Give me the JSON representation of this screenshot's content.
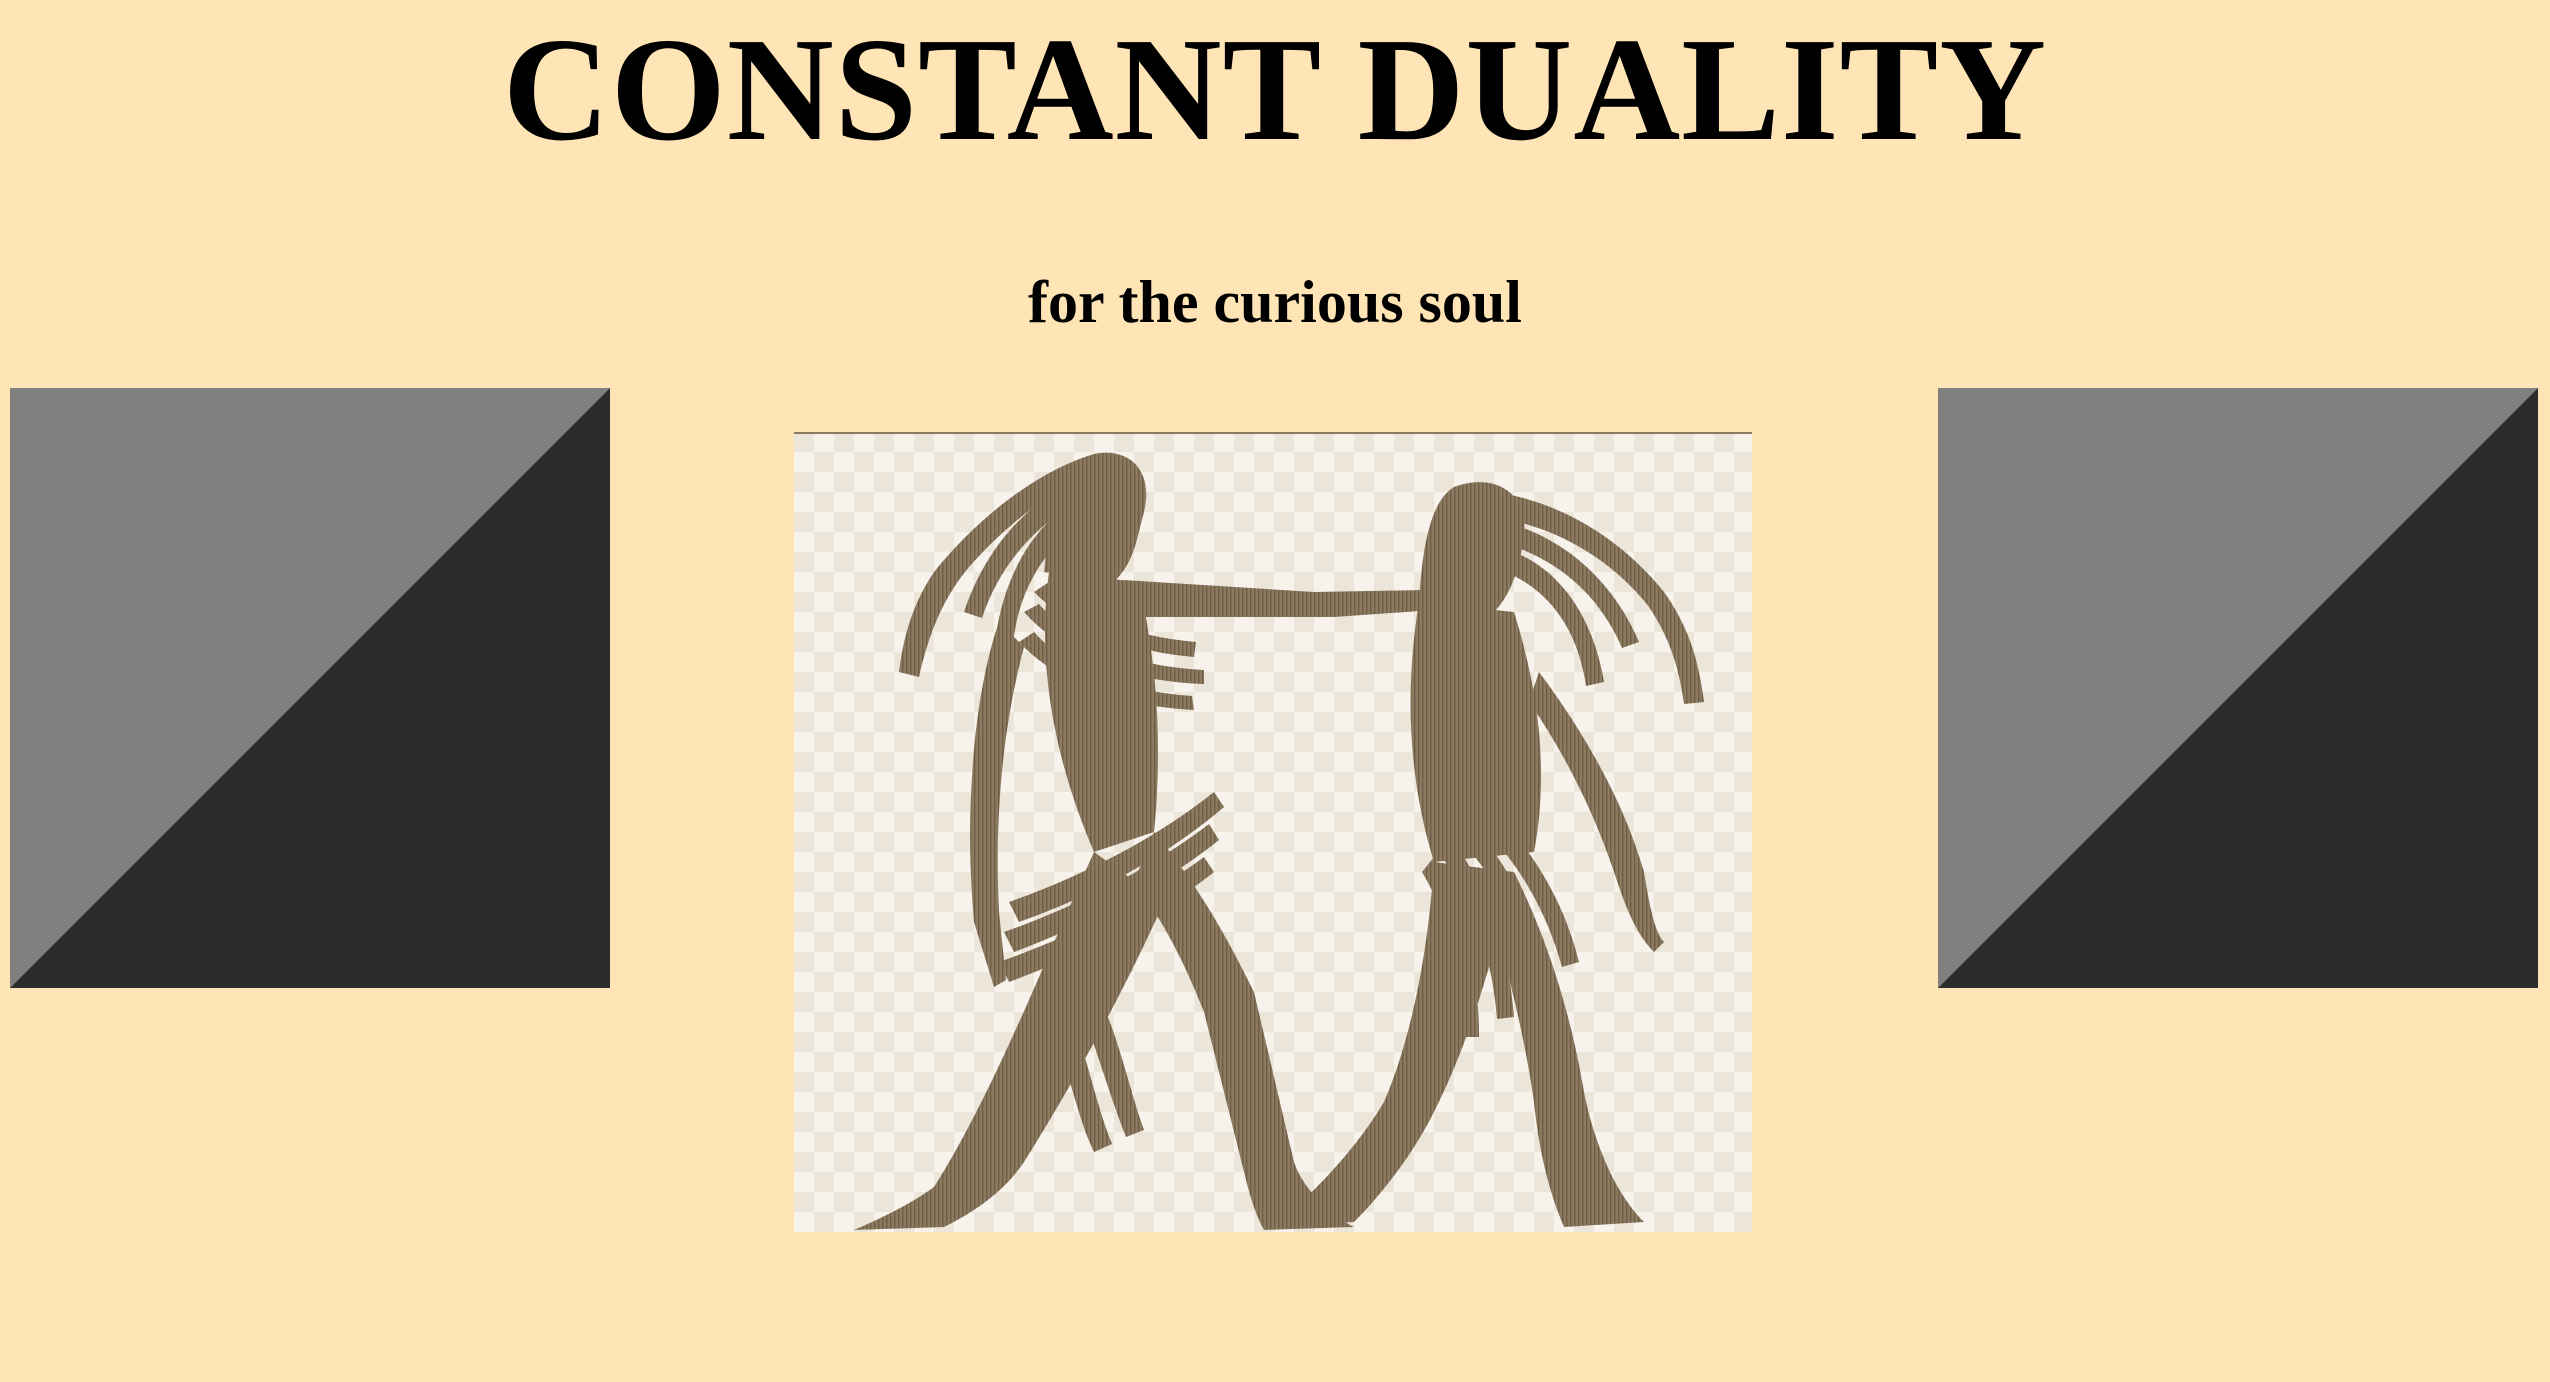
{
  "page": {
    "title": "CONSTANT DUALITY",
    "subtitle": "for the curious soul",
    "background_color": "#FFE4B6"
  },
  "decorations": {
    "left_square": {
      "light_color": "#808080",
      "dark_color": "#2B2B2B"
    },
    "right_square": {
      "light_color": "#808080",
      "dark_color": "#2B2B2B"
    }
  },
  "image": {
    "subject": "gemini-twins-illustration",
    "figure_color": "#8C7A60",
    "checker_light": "#F7F3EC",
    "checker_dark": "#EBE5DA"
  }
}
